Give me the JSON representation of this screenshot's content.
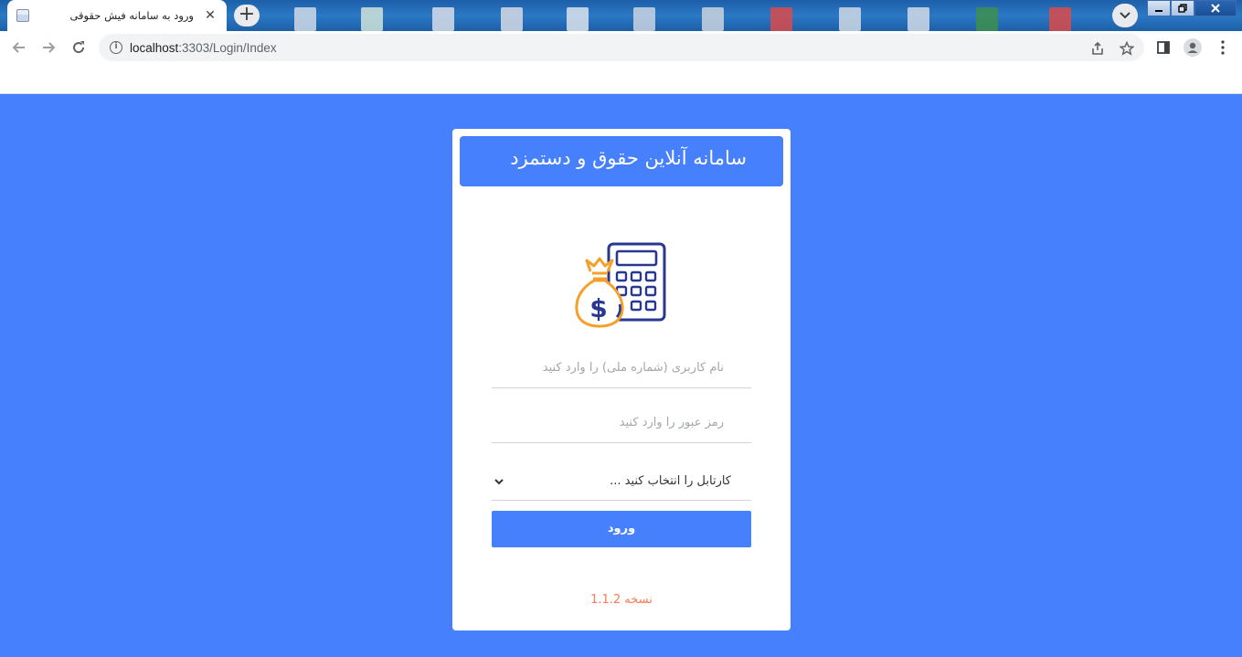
{
  "browser": {
    "tab_title": "ورود به سامانه فیش حقوقی",
    "tab_close": "✕",
    "new_tab": "+",
    "url_host": "localhost",
    "url_rest": ":3303/Login/Index",
    "icons": [
      "back-arrow-icon",
      "forward-arrow-icon",
      "reload-icon",
      "info-icon",
      "share-icon",
      "star-icon",
      "side-panel-icon",
      "profile-icon",
      "more-menu-icon",
      "tab-search-icon"
    ]
  },
  "card": {
    "title": "سامانه آنلاین حقوق و دستمزد",
    "username_placeholder": "نام کاربری (شماره ملّی) را وارد کنید",
    "password_placeholder": "رمز عبور را وارد کنید",
    "cartable_selected": "کارتابل را انتخاب کنید ...",
    "login_label": "ورود",
    "version": "نسخه 1.1.2"
  },
  "colors": {
    "page_bg": "#4680fd",
    "accent": "#4680fd",
    "version_text": "#fb7a52",
    "logo_navy": "#28378f",
    "logo_orange": "#f5a02b"
  }
}
